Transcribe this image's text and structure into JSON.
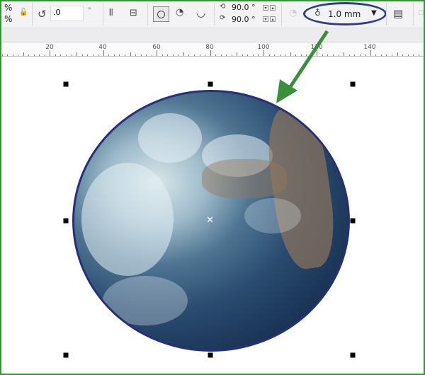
{
  "toolbar": {
    "percent_top": "%",
    "percent_bottom": "%",
    "rotation_value": ".0",
    "degree_symbol": "°",
    "start_angle": "90.0 °",
    "end_angle": "90.0 °",
    "outline_width": "1.0 mm"
  },
  "ruler": {
    "labels": [
      "20",
      "40",
      "60",
      "80",
      "100",
      "120",
      "140"
    ]
  },
  "annotation": {
    "highlight_color": "#2b3f8a",
    "arrow_color": "#3a8f3a"
  },
  "colors": {
    "frame": "#2c9a2c",
    "ellipse_outline": "#26307a"
  }
}
